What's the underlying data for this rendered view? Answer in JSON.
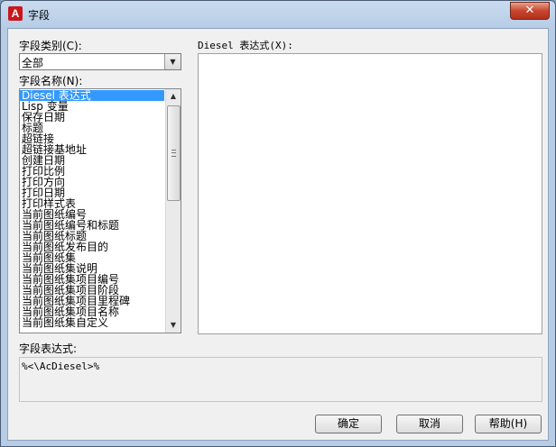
{
  "window": {
    "title": "字段",
    "icon_letter": "A",
    "close_glyph": "✕"
  },
  "category": {
    "label": "字段类别(C):",
    "selected": "全部"
  },
  "field_names": {
    "label": "字段名称(N):",
    "items": [
      "Diesel 表达式",
      "Lisp 变量",
      "保存日期",
      "标题",
      "超链接",
      "超链接基地址",
      "创建日期",
      "打印比例",
      "打印方向",
      "打印日期",
      "打印样式表",
      "当前图纸编号",
      "当前图纸编号和标题",
      "当前图纸标题",
      "当前图纸发布目的",
      "当前图纸集",
      "当前图纸集说明",
      "当前图纸集项目编号",
      "当前图纸集项目阶段",
      "当前图纸集项目里程碑",
      "当前图纸集项目名称",
      "当前图纸集自定义"
    ],
    "selected_index": 0
  },
  "diesel": {
    "label": "Diesel 表达式(X):",
    "value": ""
  },
  "field_expression": {
    "label": "字段表达式:",
    "value": "%<\\AcDiesel>%"
  },
  "buttons": {
    "ok": "确定",
    "cancel": "取消",
    "help": "帮助(H)"
  }
}
